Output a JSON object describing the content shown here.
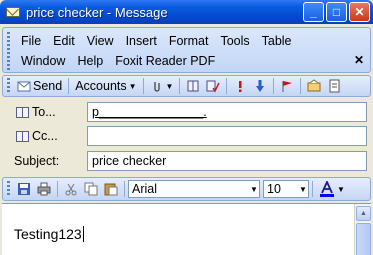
{
  "window": {
    "title": "price checker - Message",
    "controls": {
      "minimize": "_",
      "maximize": "□",
      "close": "✕"
    }
  },
  "menu": {
    "row1": [
      "File",
      "Edit",
      "View",
      "Insert",
      "Format",
      "Tools",
      "Table"
    ],
    "row2": [
      "Window",
      "Help",
      "Foxit Reader PDF"
    ],
    "close_glyph": "✕"
  },
  "toolbar": {
    "send_label": "Send",
    "accounts_label": "Accounts"
  },
  "address": {
    "to_label": "To...",
    "cc_label": "Cc...",
    "subject_label": "Subject:",
    "to_value": "p_______________.",
    "cc_value": "",
    "subject_value": "price checker"
  },
  "format": {
    "font": "Arial",
    "size": "10"
  },
  "body": {
    "text": "Testing123"
  },
  "colors": {
    "title_bar": "#0a5be0",
    "close_button": "#c9391c",
    "toolbar_bg": "#c4d6f4",
    "font_color_underline": "#0000ff"
  }
}
